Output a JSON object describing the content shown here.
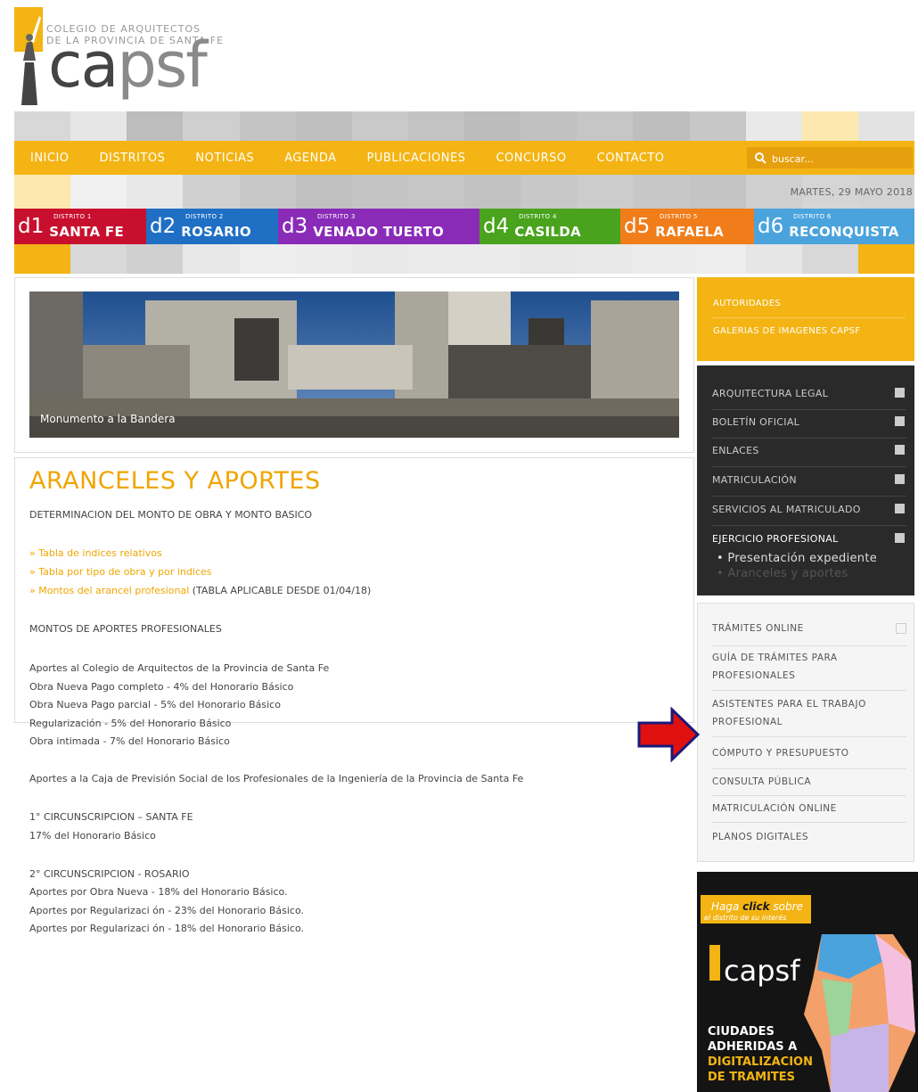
{
  "logo": {
    "line1": "COLEGIO DE ARQUITECTOS",
    "line2": "DE LA PROVINCIA DE SANTA FE",
    "word_a": "ca",
    "word_b": "psf"
  },
  "nav": {
    "items": [
      "INICIO",
      "DISTRITOS",
      "NOTICIAS",
      "AGENDA",
      "PUBLICACIONES",
      "CONCURSO",
      "CONTACTO"
    ]
  },
  "search": {
    "placeholder": "buscar..."
  },
  "date": "MARTES, 29 MAYO 2018",
  "districts": [
    {
      "num": "d1",
      "small": "DISTRITO 1",
      "name": "SANTA FE",
      "color": "#c8102e"
    },
    {
      "num": "d2",
      "small": "DISTRITO 2",
      "name": "ROSARIO",
      "color": "#1f6fc5"
    },
    {
      "num": "d3",
      "small": "DISTRITO 3",
      "name": "VENADO TUERTO",
      "color": "#8a2bb8"
    },
    {
      "num": "d4",
      "small": "DISTRITO 4",
      "name": "CASILDA",
      "color": "#49a31c"
    },
    {
      "num": "d5",
      "small": "DISTRITO 5",
      "name": "RAFAELA",
      "color": "#f07d1a"
    },
    {
      "num": "d6",
      "small": "DISTRITO 6",
      "name": "RECONQUISTA",
      "color": "#4aa3dc"
    }
  ],
  "hero": {
    "caption": "Monumento a la Bandera"
  },
  "content": {
    "title": "ARANCELES Y APORTES",
    "subtitle": "DETERMINACION DEL MONTO DE OBRA Y MONTO BASICO",
    "link1": "» Tabla de indices relativos",
    "link2": "» Tabla por tipo de obra y por indices",
    "link3": "» Montos del arancel profesional",
    "link3_note": " (TABLA APLICABLE DESDE 01/04/18)",
    "section2": "MONTOS DE APORTES PROFESIONALES",
    "colegio_head": "Aportes al Colegio de Arquitectos  de la Provincia de Santa Fe",
    "colegio_lines": [
      "Obra Nueva Pago completo - 4% del Honorario Básico",
      "Obra Nueva Pago parcial - 5% del Honorario Básico",
      "Regularización - 5% del Honorario Básico",
      "Obra intimada - 7% del Honorario Básico"
    ],
    "caja_head": "Aportes a la Caja de Previsión Social de los Profesionales de la Ingeniería de la Provincia de Santa Fe",
    "circ1_head": "1° CIRCUNSCRIPCION – SANTA FE",
    "circ1_line": "17% del Honorario Básico",
    "circ2_head": "2° CIRCUNSCRIPCION - ROSARIO",
    "circ2_lines": [
      "Aportes por Obra Nueva - 18% del Honorario Básico.",
      "Aportes por Regularizaci ón - 23% del Honorario Básico.",
      "Aportes por Regularizaci ón - 18% del Honorario Básico."
    ]
  },
  "sidebar": {
    "yellow": [
      "AUTORIDADES",
      "GALERIAS DE IMAGENES CAPSF"
    ],
    "dark": [
      "ARQUITECTURA LEGAL",
      "BOLETÍN OFICIAL",
      "ENLACES",
      "MATRICULACIÓN",
      "SERVICIOS AL MATRICULADO",
      "EJERCICIO PROFESIONAL"
    ],
    "dark_sub": [
      "• Presentación expediente",
      "• Aranceles y aportes"
    ],
    "light": [
      "TRÁMITES ONLINE",
      "GUÍA DE TRÁMITES PARA",
      "PROFESIONALES",
      "ASISTENTES PARA EL TRABAJO",
      "PROFESIONAL",
      "CÓMPUTO Y PRESUPUESTO",
      "CONSULTA PÚBLICA",
      "MATRICULACIÓN ONLINE",
      "PLANOS DIGITALES"
    ]
  },
  "banner": {
    "click1": "Haga ",
    "click2": "click",
    "click3": " sobre",
    "click_sub": "el distrito de su interés",
    "logo": "capsf",
    "line1": "CIUDADES",
    "line2": "ADHERIDAS A",
    "line3": "DIGITALIZACION",
    "line4": "DE TRAMITES"
  },
  "colors": {
    "accent": "#f3b414",
    "title": "#f0a500",
    "sidebar_dark": "#2a2a2a",
    "arrow": "#e01010"
  }
}
